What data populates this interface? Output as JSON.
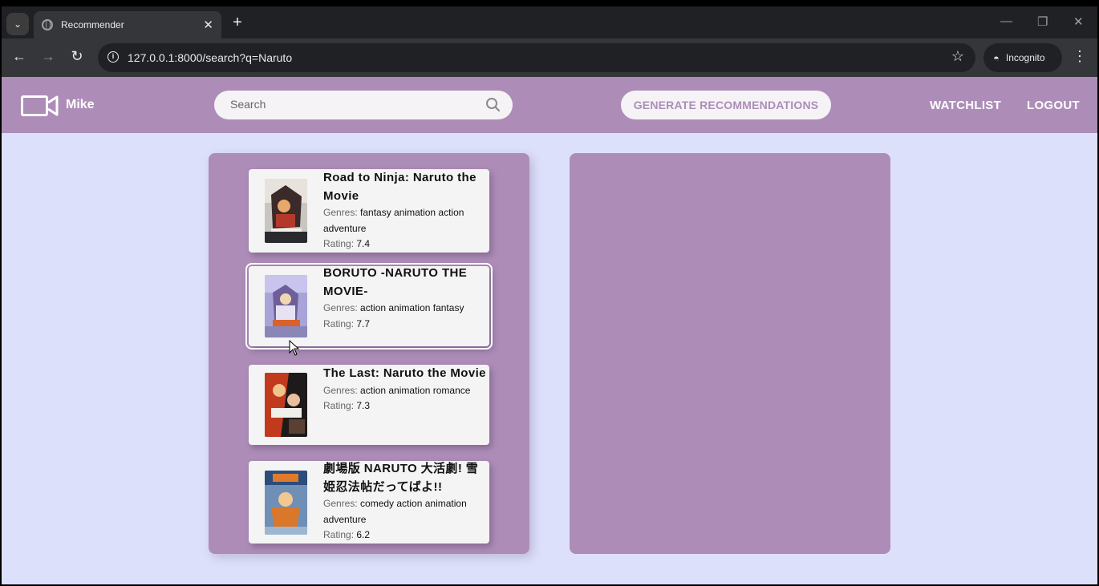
{
  "browser": {
    "tab_title": "Recommender",
    "url": "127.0.0.1:8000/search?q=Naruto",
    "incognito_label": "Incognito"
  },
  "header": {
    "username": "Mike",
    "search_placeholder": "Search",
    "generate_label": "GENERATE RECOMMENDATIONS",
    "watchlist_label": "WATCHLIST",
    "logout_label": "LOGOUT"
  },
  "labels": {
    "genres": "Genres:",
    "rating": "Rating:"
  },
  "results": [
    {
      "title": "Road to Ninja: Naruto the Movie",
      "genres": "fantasy animation action adventure",
      "rating": "7.4"
    },
    {
      "title": "BORUTO -NARUTO THE MOVIE-",
      "genres": "action animation fantasy",
      "rating": "7.7"
    },
    {
      "title": "The Last: Naruto the Movie",
      "genres": "action animation romance",
      "rating": "7.3"
    },
    {
      "title": "劇場版 NARUTO 大活劇! 雪姫忍法帖だってばよ!!",
      "genres": "comedy action animation adventure",
      "rating": "6.2"
    }
  ],
  "colors": {
    "header": "#ad8db8",
    "page_bg": "#dde0fb",
    "card_bg": "#f4f4f4"
  }
}
